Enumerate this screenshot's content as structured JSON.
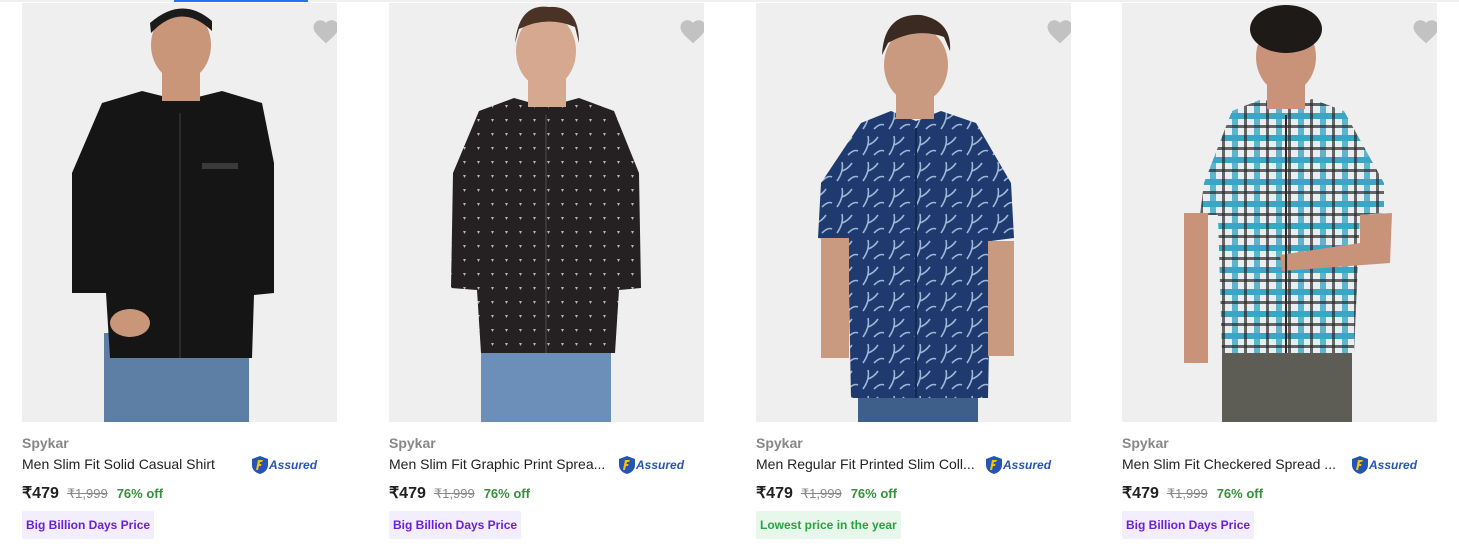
{
  "products": [
    {
      "brand": "Spykar",
      "title": "Men Slim Fit Solid Casual Shirt",
      "assured_label": "Assured",
      "price": "₹479",
      "mrp": "₹1,999",
      "discount": "76% off",
      "tag": "Big Billion Days Price",
      "shirt_color": "#151515",
      "pattern": "solid"
    },
    {
      "brand": "Spykar",
      "title": "Men Slim Fit Graphic Print Sprea...",
      "assured_label": "Assured",
      "price": "₹479",
      "mrp": "₹1,999",
      "discount": "76% off",
      "tag": "Big Billion Days Price",
      "shirt_color": "#252122",
      "pattern": "dots"
    },
    {
      "brand": "Spykar",
      "title": "Men Regular Fit Printed Slim Coll...",
      "assured_label": "Assured",
      "price": "₹479",
      "mrp": "₹1,999",
      "discount": "76% off",
      "tag": "Lowest price in the year",
      "shirt_color": "#1e3a6e",
      "pattern": "floral"
    },
    {
      "brand": "Spykar",
      "title": "Men Slim Fit Checkered Spread ...",
      "assured_label": "Assured",
      "price": "₹479",
      "mrp": "₹1,999",
      "discount": "76% off",
      "tag": "Big Billion Days Price",
      "shirt_color": "#e9eef0",
      "pattern": "check"
    }
  ],
  "colors": {
    "accent": "#2874f0",
    "discount": "#388e3c",
    "tag_purple_text": "#6b1fd6",
    "tag_green_text": "#26a541",
    "assured": "#2455b5"
  }
}
